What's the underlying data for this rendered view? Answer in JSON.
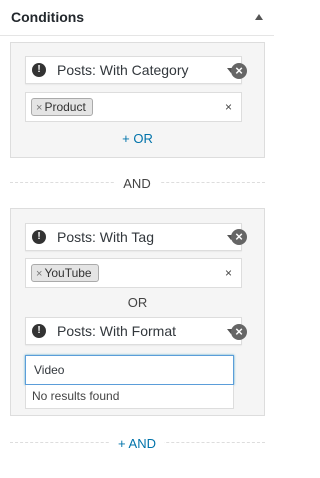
{
  "panel": {
    "title": "Conditions",
    "collapse_icon": "triangle-up-icon"
  },
  "group1": {
    "rules": [
      {
        "label": "Posts: With Category",
        "icon": "exclamation-icon",
        "tags": [
          "Product"
        ],
        "clear_label": "×",
        "remove_label": "×"
      }
    ],
    "add_or_label": "+ OR"
  },
  "and_separator": "AND",
  "group2": {
    "rules": [
      {
        "label": "Posts: With Tag",
        "icon": "exclamation-icon",
        "tags": [
          "YouTube"
        ],
        "clear_label": "×",
        "remove_label": "×"
      },
      {
        "label": "Posts: With Format",
        "icon": "exclamation-icon",
        "remove_label": "×",
        "search_value": "Video",
        "results_text": "No results found"
      }
    ],
    "or_separator": "OR"
  },
  "add_and_label": "+ AND",
  "colors": {
    "accent": "#0073aa",
    "focus_border": "#5b9dd9"
  }
}
